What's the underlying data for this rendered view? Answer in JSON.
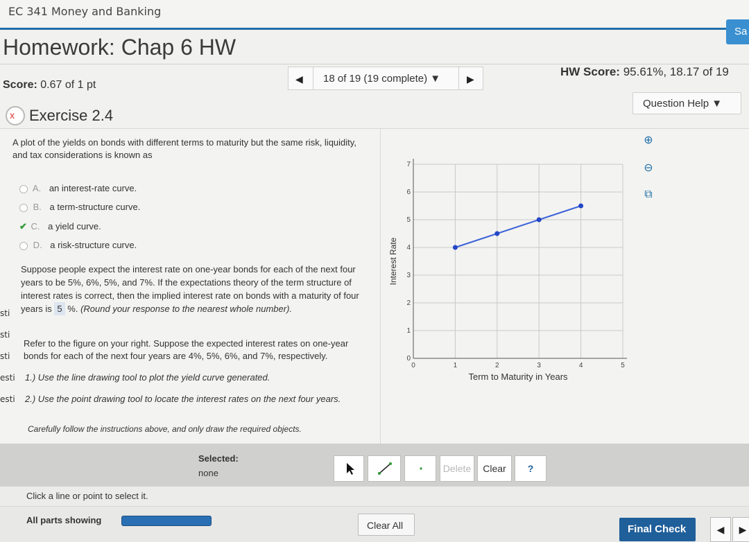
{
  "course": "EC 341 Money and Banking",
  "save_label": "Sa",
  "hw_title": "Homework: Chap 6 HW",
  "score": {
    "label": "Score:",
    "value": "0.67 of 1 pt"
  },
  "nav": {
    "prev": "◀",
    "position": "18 of 19 (19 complete) ▼",
    "next": "▶"
  },
  "hw_score": {
    "label": "HW Score:",
    "value": "95.61%, 18.17 of 19"
  },
  "question_help": "Question Help ▼",
  "exercise": {
    "title": "Exercise 2.4",
    "icon": "x"
  },
  "part1": {
    "prompt": "A plot of the yields on bonds with different terms to maturity but the same risk, liquidity, and tax considerations is known as",
    "choices": [
      {
        "letter": "A.",
        "text": "an interest-rate curve.",
        "selected": false
      },
      {
        "letter": "B.",
        "text": "a term-structure curve.",
        "selected": false
      },
      {
        "letter": "C.",
        "text": "a yield curve.",
        "selected": true
      },
      {
        "letter": "D.",
        "text": "a risk-structure curve.",
        "selected": false
      }
    ]
  },
  "part2": {
    "text_before": "Suppose people expect the interest rate on one-year bonds for each of the next four years to be 5%, 6%, 5%, and 7%. If the expectations theory of the term structure of interest rates is correct, then the implied interest rate on bonds with a maturity of four years is",
    "answer": "5",
    "text_after": "%.",
    "hint": "(Round your response to the nearest whole number)."
  },
  "part3": {
    "text": "Refer to the figure on your right. Suppose the expected interest rates on one-year bonds for each of the next four years are 4%, 5%, 6%, and 7%, respectively.",
    "step1": "1.) Use the line drawing tool to plot the yield curve generated.",
    "step2": "2.) Use the point drawing tool to locate the interest rates on the next four years.",
    "careful": "Carefully follow the instructions above, and only draw the required objects."
  },
  "left_edge": [
    "st",
    "sti",
    "st",
    "sti",
    "sti",
    "esti",
    "esti"
  ],
  "chart_data": {
    "type": "line",
    "xlabel": "Term to Maturity in Years",
    "ylabel": "Interest Rate",
    "xlim": [
      0,
      5
    ],
    "ylim": [
      0,
      7
    ],
    "x_ticks": [
      "0",
      "1",
      "2",
      "3",
      "4",
      "5"
    ],
    "y_ticks": [
      "0",
      "1",
      "2",
      "3",
      "4",
      "5",
      "6",
      "7"
    ],
    "grid": true,
    "series": [
      {
        "x": [
          1,
          2,
          3,
          4
        ],
        "y": [
          4.0,
          4.5,
          5.0,
          5.5
        ]
      }
    ],
    "colors": {
      "line": "#3d63d8",
      "point": "#2346c8",
      "grid": "#c9c9c9"
    }
  },
  "toolbar": {
    "selected_label": "Selected:",
    "selected_value": "none",
    "delete_label": "Delete",
    "clear_label": "Clear",
    "help_label": "?"
  },
  "click_hint": "Click a line or point to select it.",
  "footer": {
    "parts_label": "All parts showing",
    "clear_all": "Clear All",
    "final_check": "Final Check",
    "prev": "◀",
    "next": "▶"
  },
  "colors": {
    "accent": "#1f6fa8",
    "final_check": "#1f5f9a",
    "correct": "#2e9a35"
  }
}
